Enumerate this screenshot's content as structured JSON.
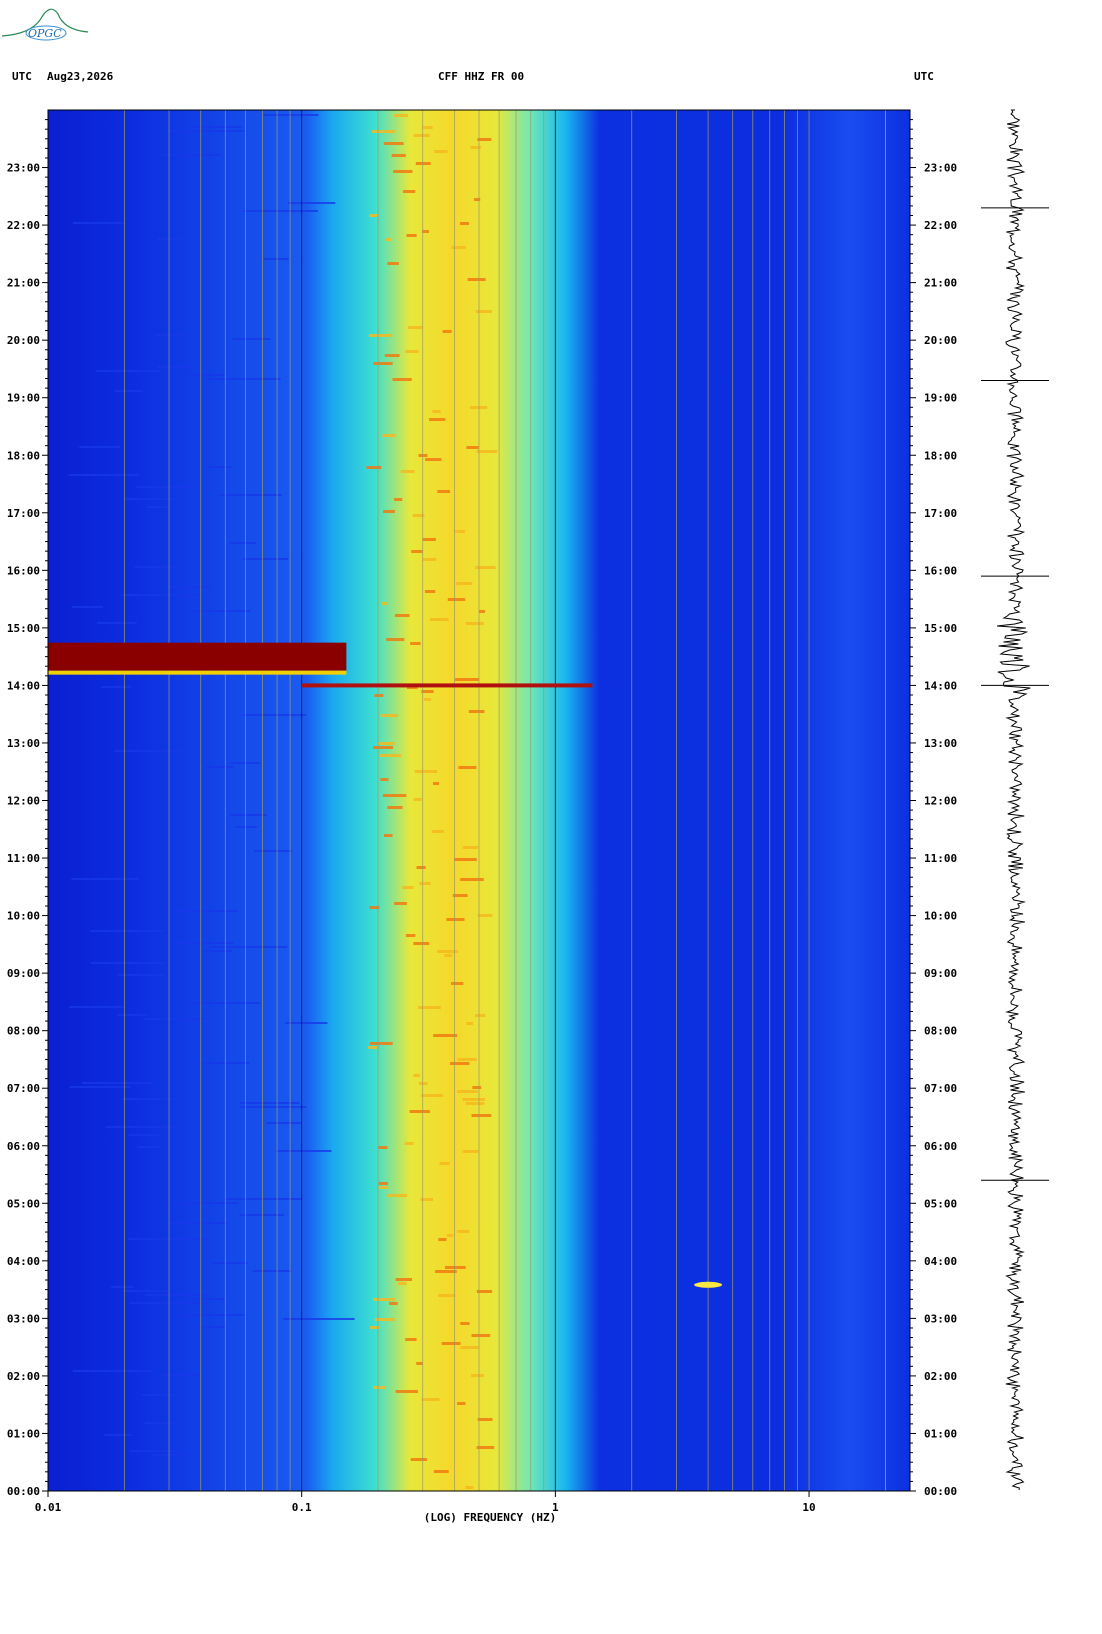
{
  "header": {
    "left_utc": "UTC",
    "date": "Aug23,2026",
    "station": "CFF HHZ FR 00",
    "right_utc": "UTC"
  },
  "logo": {
    "text": "OPGC",
    "color": "#2e8b57"
  },
  "colors": {
    "background_low": "#0a1fd0",
    "mid_cyan": "#19c8e8",
    "mid_yellow": "#f2e62a",
    "high_orange": "#f07a10",
    "high_red": "#8a0000",
    "gridline": "#9a9a6a"
  },
  "chart_data": {
    "type": "heatmap",
    "title": "CFF HHZ FR 00",
    "xlabel": "(LOG) FREQUENCY (HZ)",
    "xscale": "log",
    "xlim": [
      0.01,
      25
    ],
    "x_tick_labels": [
      "0.01",
      "0.1",
      "1",
      "10"
    ],
    "x_tick_values": [
      0.01,
      0.1,
      1,
      10
    ],
    "ylabel": "UTC",
    "y_tick_labels": [
      "00:00",
      "01:00",
      "02:00",
      "03:00",
      "04:00",
      "05:00",
      "06:00",
      "07:00",
      "08:00",
      "09:00",
      "10:00",
      "11:00",
      "12:00",
      "13:00",
      "14:00",
      "15:00",
      "16:00",
      "17:00",
      "18:00",
      "19:00",
      "20:00",
      "21:00",
      "22:00",
      "23:00"
    ],
    "ylim_hours": [
      0,
      24
    ],
    "dominant_band_hz": [
      0.18,
      0.5
    ],
    "events": [
      {
        "time": "14:00",
        "freq_range_hz": [
          0.1,
          1.4
        ],
        "note": "strong broadband line"
      },
      {
        "time": "14:30",
        "freq_range_hz": [
          0.01,
          0.15
        ],
        "note": "very high power at low frequencies"
      },
      {
        "time": "03:35",
        "freq_hz": 4.0
      }
    ],
    "seismogram": {
      "time_range_hours": [
        0,
        24
      ]
    }
  }
}
